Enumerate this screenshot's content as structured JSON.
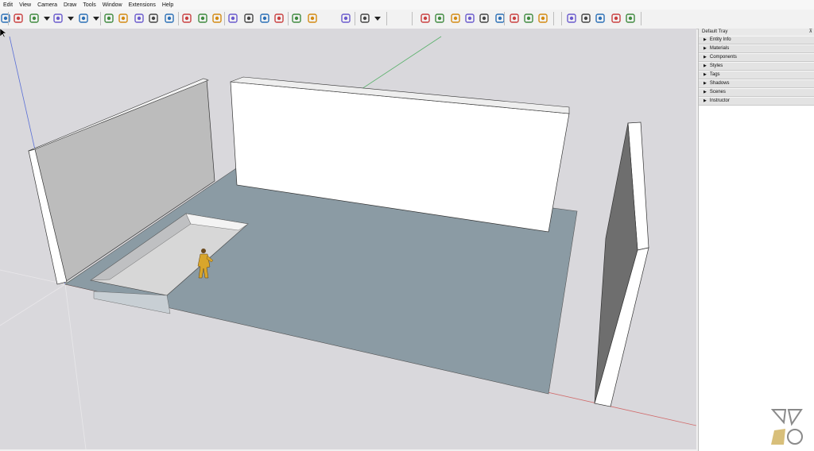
{
  "menu": [
    "Edit",
    "View",
    "Camera",
    "Draw",
    "Tools",
    "Window",
    "Extensions",
    "Help"
  ],
  "toolbar_tools": [
    "select-tool",
    "eraser-tool",
    "pencil-tool",
    "dropdown",
    "arc-tool",
    "dropdown",
    "rectangle-tool",
    "dropdown",
    "push-pull-tool",
    "follow-me-tool",
    "move-tool",
    "rotate-tool",
    "scale-tool",
    "tape-measure-tool",
    "text-tool",
    "paint-bucket-tool",
    "orbit-tool",
    "pan-tool",
    "zoom-tool",
    "zoom-extents-tool",
    "sandbox-tool",
    "sandbox-smoove-tool",
    "sandbox-drape-tool",
    "account-icon",
    "dropdown",
    "section-plane-tool",
    "position-camera-tool",
    "zoom-tool",
    "zoom-window-tool",
    "zoom-extents-tool",
    "look-around-tool",
    "walk-tool",
    "footprints-tool",
    "3d-warehouse-icon",
    "extension-warehouse-icon",
    "home-icon",
    "house-icon",
    "house-outline-icon",
    "layout-icon"
  ],
  "tray": {
    "title": "Default Tray",
    "pin": "⊼",
    "panels": [
      "Entity Info",
      "Materials",
      "Components",
      "Styles",
      "Tags",
      "Shadows",
      "Scenes",
      "Instructor"
    ]
  },
  "colors": {
    "floor": "#8a9aa3",
    "wall_side": "#bbbbbb",
    "wall_face": "#ffffff",
    "background": "#d9d8dc",
    "red_axis": "#c0504d",
    "green_axis": "#4caf50",
    "blue_axis": "#3f51b5"
  }
}
